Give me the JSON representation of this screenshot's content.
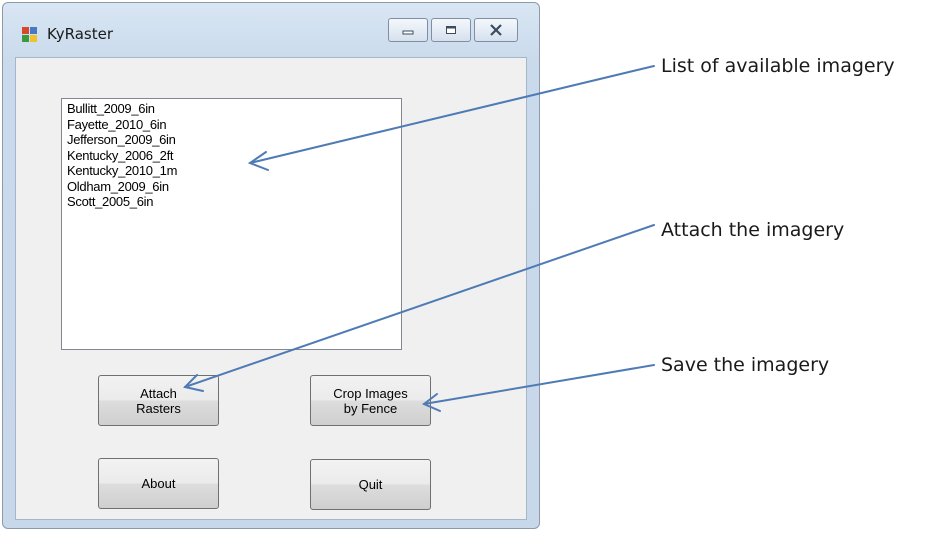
{
  "window": {
    "title": "KyRaster",
    "controls": [
      "minimize-icon",
      "maximize-icon",
      "close-icon"
    ]
  },
  "imagery_list": {
    "items": [
      "Bullitt_2009_6in",
      "Fayette_2010_6in",
      "Jefferson_2009_6in",
      "Kentucky_2006_2ft",
      "Kentucky_2010_1m",
      "Oldham_2009_6in",
      "Scott_2005_6in"
    ]
  },
  "buttons": {
    "attach": "Attach\nRasters",
    "crop": "Crop Images\nby Fence",
    "about": "About",
    "quit": "Quit"
  },
  "annotations": {
    "list": "List of available imagery",
    "attach": "Attach the imagery",
    "save": "Save the imagery"
  },
  "colors": {
    "arrow": "#4f7bb5"
  }
}
